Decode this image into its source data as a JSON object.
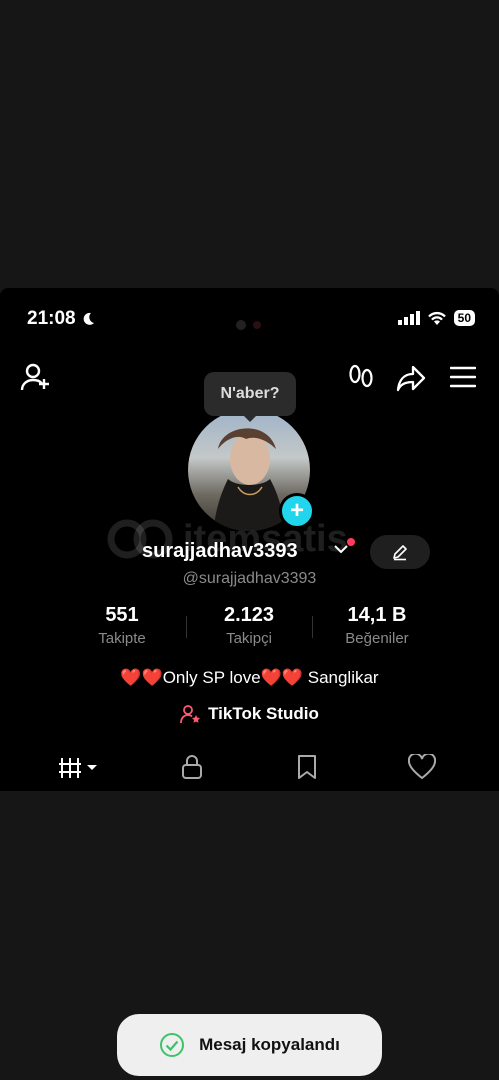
{
  "status_bar": {
    "time": "21:08",
    "battery": "50"
  },
  "tooltip": {
    "text": "N'aber?"
  },
  "profile": {
    "username": "surajjadhav3393",
    "handle": "@surajjadhav3393",
    "bio": "❤️❤️Only SP love❤️❤️ Sanglikar",
    "studio_label": "TikTok Studio"
  },
  "stats": [
    {
      "value": "551",
      "label": "Takipte"
    },
    {
      "value": "2.123",
      "label": "Takipçi"
    },
    {
      "value": "14,1 B",
      "label": "Beğeniler"
    }
  ],
  "watermark": {
    "text": "itemsatis"
  },
  "toast": {
    "text": "Mesaj kopyalandı"
  },
  "colors": {
    "accent_cyan": "#20d5ec",
    "notification_red": "#ff3b5c",
    "toast_check_green": "#3cc36a"
  },
  "icons": [
    "add-friend-icon",
    "footprints-icon",
    "share-icon",
    "menu-icon",
    "chevron-down-icon",
    "edit-icon",
    "grid-icon",
    "lock-icon",
    "bookmark-icon",
    "heart-icon",
    "studio-icon",
    "check-icon"
  ]
}
